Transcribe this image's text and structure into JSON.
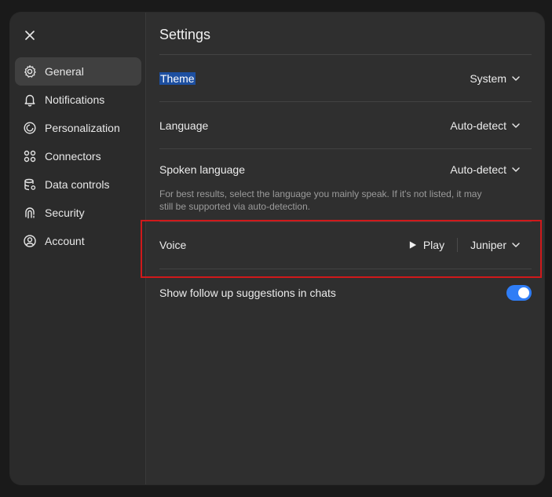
{
  "sidebar": {
    "close_icon": "close-icon",
    "items": [
      {
        "label": "General",
        "icon": "gear-icon",
        "active": true
      },
      {
        "label": "Notifications",
        "icon": "bell-icon",
        "active": false
      },
      {
        "label": "Personalization",
        "icon": "personalization-icon",
        "active": false
      },
      {
        "label": "Connectors",
        "icon": "connectors-icon",
        "active": false
      },
      {
        "label": "Data controls",
        "icon": "database-icon",
        "active": false
      },
      {
        "label": "Security",
        "icon": "fingerprint-icon",
        "active": false
      },
      {
        "label": "Account",
        "icon": "account-icon",
        "active": false
      }
    ]
  },
  "main": {
    "title": "Settings",
    "theme": {
      "label": "Theme",
      "value": "System"
    },
    "language": {
      "label": "Language",
      "value": "Auto-detect"
    },
    "spoken_language": {
      "label": "Spoken language",
      "value": "Auto-detect",
      "help": "For best results, select the language you mainly speak. If it's not listed, it may still be supported via auto-detection."
    },
    "voice": {
      "label": "Voice",
      "play_label": "Play",
      "value": "Juniper"
    },
    "follow_up": {
      "label": "Show follow up suggestions in chats",
      "enabled": true
    }
  },
  "colors": {
    "accent": "#2f7df6",
    "highlight": "#d0191b",
    "selection": "#1d4fa0"
  }
}
